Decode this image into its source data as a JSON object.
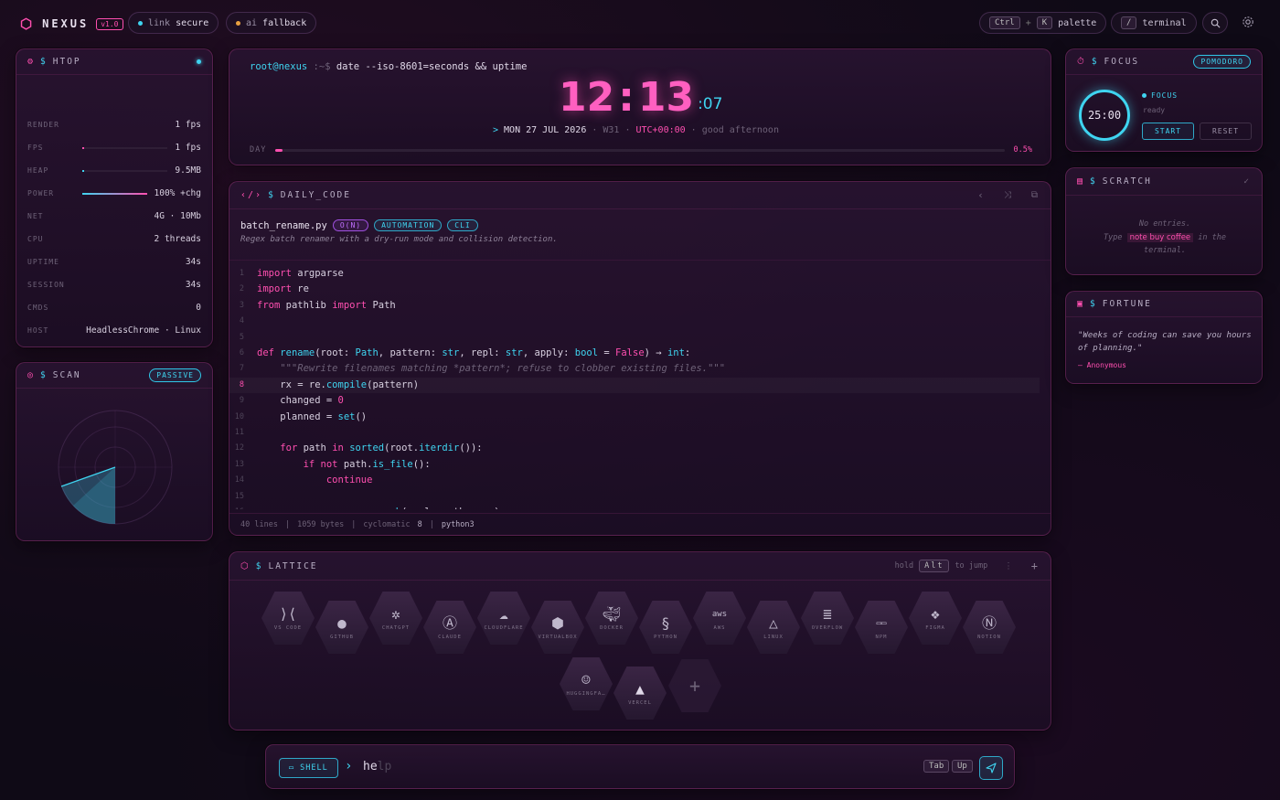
{
  "topbar": {
    "logo": "NEXUS",
    "version": "v1.0",
    "link_label": "link",
    "link_state": "secure",
    "ai_label": "ai",
    "ai_state": "fallback",
    "palette_key1": "Ctrl",
    "palette_plus": "+",
    "palette_key2": "K",
    "palette_label": "palette",
    "terminal_key": "/",
    "terminal_label": "terminal"
  },
  "htop": {
    "title": "HTOP",
    "rows": [
      {
        "label": "RENDER",
        "value": "1 fps"
      },
      {
        "label": "FPS",
        "value": "1 fps",
        "bar": 0.02
      },
      {
        "label": "HEAP",
        "value": "9.5MB",
        "bar": 0.02
      },
      {
        "label": "POWER",
        "value": "100% +chg",
        "bar": 1.0
      },
      {
        "label": "NET",
        "value": "4G · 10Mb"
      },
      {
        "label": "CPU",
        "value": "2 threads"
      },
      {
        "label": "UPTIME",
        "value": "34s"
      },
      {
        "label": "SESSION",
        "value": "34s"
      },
      {
        "label": "CMDS",
        "value": "0"
      },
      {
        "label": "HOST",
        "value": "HeadlessChrome · Linux"
      }
    ]
  },
  "scan": {
    "title": "SCAN",
    "badge": "PASSIVE"
  },
  "clock": {
    "prompt_user": "root@nexus",
    "prompt_path": ":~$",
    "command": "date --iso-8601=seconds && uptime",
    "hh": "12",
    "mm": "13",
    "ss": ":07",
    "date_prefix": ">",
    "date": "MON 27 JUL 2026",
    "week": "W31",
    "tz": "UTC+00:00",
    "greeting": "good afternoon",
    "day_label": "DAY",
    "day_pct": "0.5%",
    "day_progress": 0.005
  },
  "daily_code": {
    "title": "DAILY_CODE",
    "filename": "batch_rename.py",
    "tags": [
      "O(N)",
      "AUTOMATION",
      "CLI"
    ],
    "description": "Regex batch renamer with a dry-run mode and collision detection.",
    "footer": {
      "lines": "40 lines",
      "bytes": "1059 bytes",
      "cyclomatic_label": "cyclomatic",
      "cyclomatic": "8",
      "lang": "python3"
    }
  },
  "focus": {
    "title": "FOCUS",
    "badge": "POMODORO",
    "timer": "25:00",
    "mode": "FOCUS",
    "state": "ready",
    "start": "START",
    "reset": "RESET"
  },
  "scratch": {
    "title": "SCRATCH",
    "empty": "No entries.",
    "hint_pre": "Type",
    "hint_cmd": "note buy coffee",
    "hint_post": "in the",
    "hint_end": "terminal."
  },
  "fortune": {
    "title": "FORTUNE",
    "quote": "\"Weeks of coding can save you hours of planning.\"",
    "author": "— Anonymous"
  },
  "lattice": {
    "title": "LATTICE",
    "hint_pre": "hold",
    "hint_key": "Alt",
    "hint_post": "to jump",
    "tiles": [
      "VS CODE",
      "GITHUB",
      "CHATGPT",
      "CLAUDE",
      "CLOUDFLARE",
      "VIRTUALBOX",
      "DOCKER",
      "PYTHON",
      "AWS",
      "LINUX",
      "OVERFLOW",
      "NPM",
      "FIGMA",
      "NOTION",
      "HUGGINGFA…",
      "VERCEL"
    ]
  },
  "shell": {
    "badge": "SHELL",
    "typed": "he",
    "ghost": "lp",
    "key_tab": "Tab",
    "key_up": "Up"
  },
  "colors": {
    "accent_pink": "#ff4fb0",
    "accent_cyan": "#3fd4f0"
  }
}
